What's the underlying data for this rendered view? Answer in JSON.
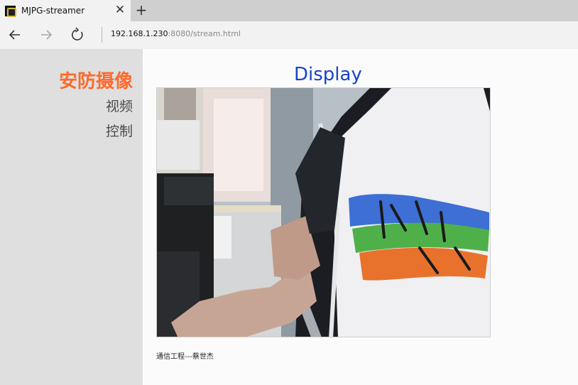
{
  "browser": {
    "tab_title": "MJPG-streamer",
    "tab_close_icon": "close-icon",
    "new_tab_icon": "plus-icon",
    "url_host": "192.168.1.230",
    "url_rest": ":8080/stream.html"
  },
  "sidebar": {
    "brand": "安防摄像",
    "links": [
      "视频",
      "控制"
    ]
  },
  "main": {
    "title": "Display",
    "footer": "通信工程---蔡世杰"
  },
  "colors": {
    "brand": "#ff6a2b",
    "title": "#1745c9",
    "sidebar_bg": "#dfdfdf"
  }
}
